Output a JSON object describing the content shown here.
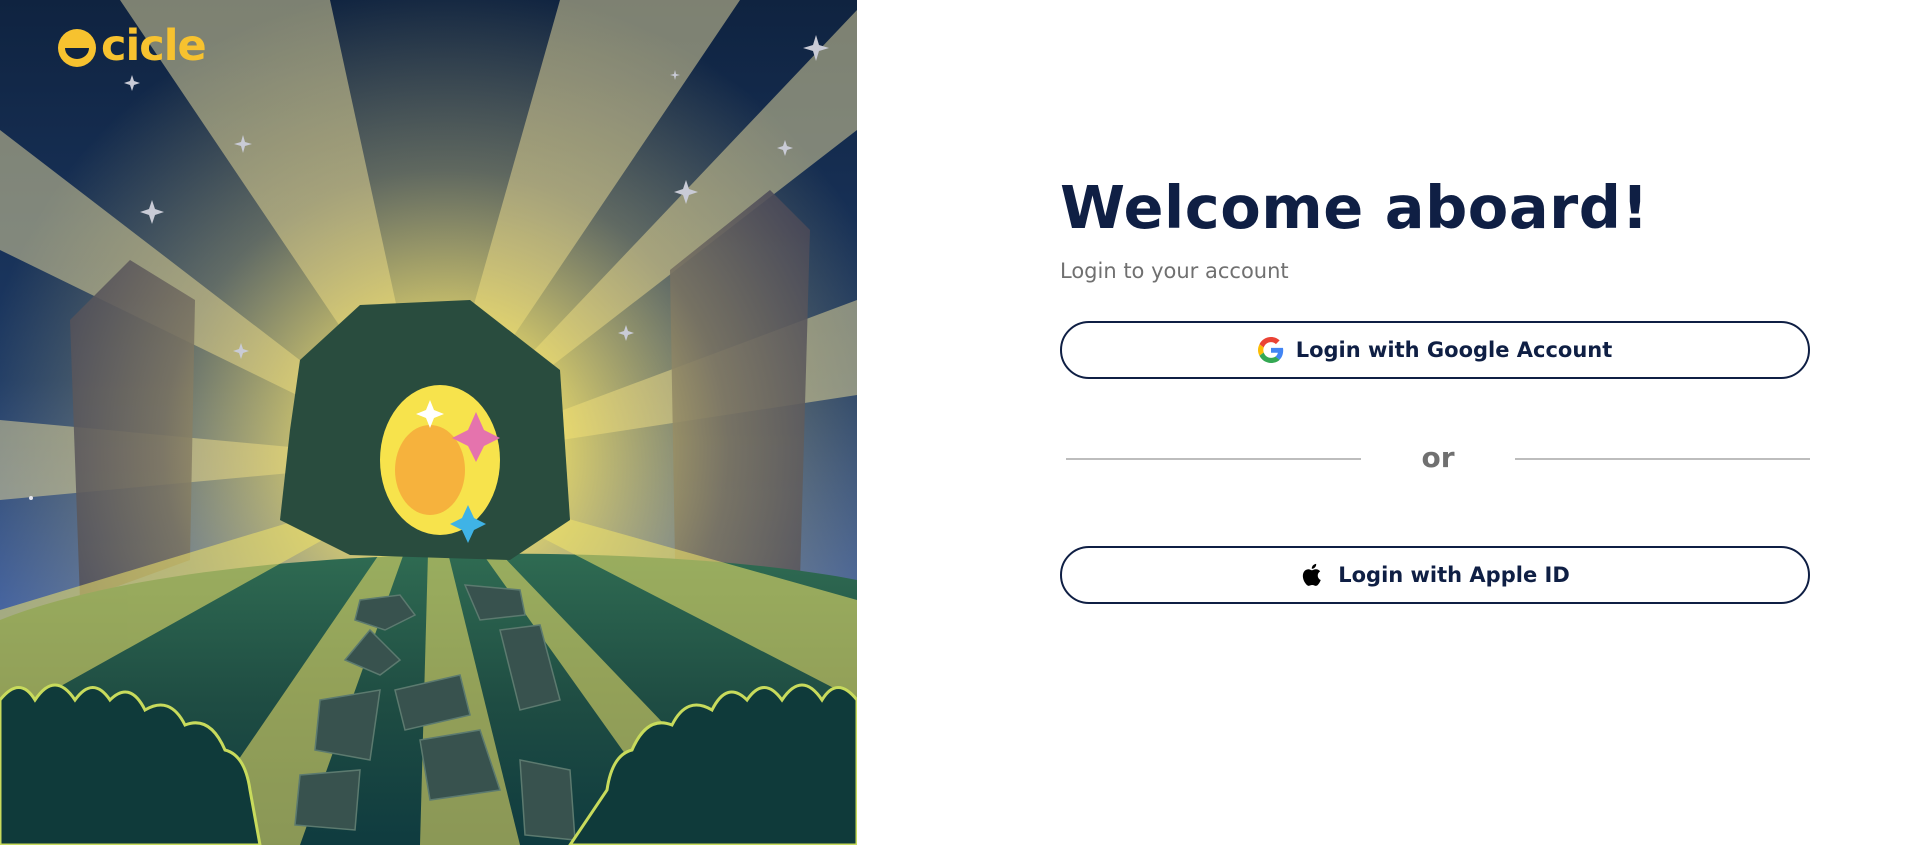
{
  "brand": {
    "name": "cicle",
    "color": "#f7c22f"
  },
  "login": {
    "title": "Welcome aboard!",
    "subtitle": "Login to your account",
    "google_button": {
      "label": "Login with Google Account",
      "icon": "google-icon"
    },
    "divider_text": "or",
    "apple_button": {
      "label": "Login with Apple ID",
      "icon": "apple-icon"
    }
  },
  "colors": {
    "heading": "#0f1f44",
    "muted_text": "#707070",
    "button_border": "#0f1f44",
    "divider_line": "#bdbdbd"
  }
}
